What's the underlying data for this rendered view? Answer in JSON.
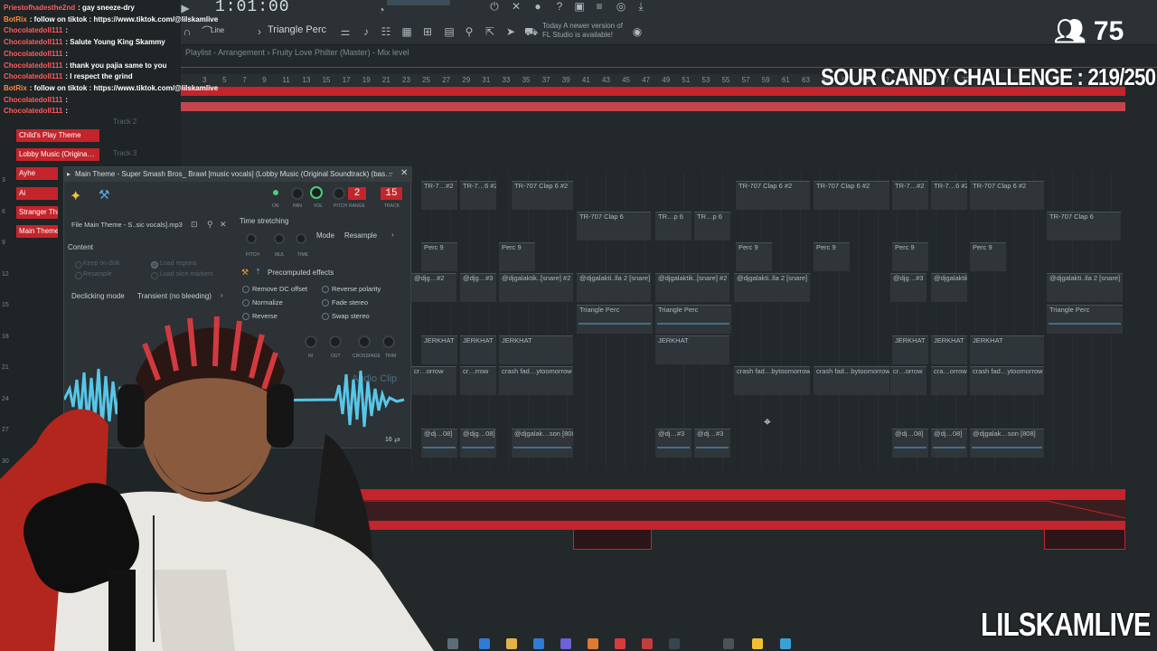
{
  "stream": {
    "viewer_count": "75",
    "challenge": "SOUR CANDY CHALLENGE : 219/250",
    "brand": "LILSKAMLIVE"
  },
  "toolbar": {
    "time": "1:01:00",
    "pattern": "Triangle Perc",
    "snap": "Line",
    "news_line1": "Today  A newer version of",
    "news_line2": "FL Studio is available!"
  },
  "playlist": {
    "title": "Playlist - Arrangement  ›  Fruity Love Philter (Master) - Mix level",
    "bar_numbers": [
      "3",
      "5",
      "7",
      "9",
      "11",
      "13",
      "15",
      "17",
      "19",
      "21",
      "23",
      "25",
      "27",
      "29",
      "31",
      "33",
      "35",
      "37",
      "39",
      "41",
      "43",
      "45",
      "47",
      "49",
      "51",
      "53",
      "55",
      "57",
      "59",
      "61",
      "63",
      "65",
      "67",
      "69",
      "71",
      "73",
      "75",
      "77",
      "79"
    ],
    "row_numbers": [
      "3",
      "6",
      "9",
      "12",
      "15",
      "18",
      "21",
      "24",
      "27",
      "30"
    ],
    "clips": [
      {
        "label": "TR-7…#2"
      },
      {
        "label": "TR-7…6 #2"
      },
      {
        "label": "TR-707 Clap 6 #2"
      },
      {
        "label": "TR-707 Clap 6 #2"
      },
      {
        "label": "TR-707 Clap 6 #2"
      },
      {
        "label": "TR-7…#2"
      },
      {
        "label": "TR-7…6 #2"
      },
      {
        "label": "TR-707 Clap 6 #2"
      },
      {
        "label": "TR-707 Clap 6"
      },
      {
        "label": "TR…p 6"
      },
      {
        "label": "TR…p 6"
      },
      {
        "label": "TR-707 Clap 6"
      },
      {
        "label": "Perc 9"
      },
      {
        "label": "Perc 9"
      },
      {
        "label": "Perc 9"
      },
      {
        "label": "Perc 9"
      },
      {
        "label": "Perc 9"
      },
      {
        "label": "Perc 9"
      },
      {
        "label": "@djg…#2"
      },
      {
        "label": "@djg…#3"
      },
      {
        "label": "@djgalaktik..[snare] #2"
      },
      {
        "label": "@djgalakti..lla 2 [snare]"
      },
      {
        "label": "@djgalaktik..[snare] #2"
      },
      {
        "label": "@djgalakti..lla 2 [snare]"
      },
      {
        "label": "@djg…#3"
      },
      {
        "label": "@djgalaktik..[snare] #2"
      },
      {
        "label": "@djgalakti..lla 2 [snare]"
      },
      {
        "label": "Triangle Perc"
      },
      {
        "label": "Triangle Perc"
      },
      {
        "label": "Triangle Perc"
      },
      {
        "label": "JERKHAT"
      },
      {
        "label": "JERKHAT"
      },
      {
        "label": "JERKHAT"
      },
      {
        "label": "JERKHAT"
      },
      {
        "label": "JERKHAT"
      },
      {
        "label": "JERKHAT"
      },
      {
        "label": "JERKHAT"
      },
      {
        "label": "cr…orrow"
      },
      {
        "label": "cr…rrow"
      },
      {
        "label": "crash fad…ytoomorrow"
      },
      {
        "label": "crash fad…bytoomorrow"
      },
      {
        "label": "crash fad…bytoomorrow"
      },
      {
        "label": "cr…orrow"
      },
      {
        "label": "cra…orrow"
      },
      {
        "label": "crash fad…ytoomorrow"
      },
      {
        "label": "@dj…08]"
      },
      {
        "label": "@djg…08]"
      },
      {
        "label": "@djgalak…son [808]"
      },
      {
        "label": "@dj…#3"
      },
      {
        "label": "@dj…#3"
      },
      {
        "label": "@dj…08]"
      },
      {
        "label": "@dj…08]"
      },
      {
        "label": "@djgalak…son [808]"
      }
    ]
  },
  "sidebar": {
    "tracks": [
      "Child's Play Theme",
      "Lobby Music (Origina…",
      "Ayhe",
      "Ai",
      "Stranger Thin",
      "Main Theme -"
    ],
    "ghost_tracks": [
      "Track 2",
      "Track 3"
    ]
  },
  "chat": [
    {
      "user": "Priestofhadesthe2nd",
      "msg": ": gay sneeze-dry",
      "bot": false
    },
    {
      "user": "BotRix",
      "msg": ": follow on tiktok : https://www.tiktok.com/@lilskamlive",
      "bot": true
    },
    {
      "user": "Chocolatedoll111",
      "msg": ":",
      "bot": false
    },
    {
      "user": "Chocolatedoll111",
      "msg": ": Salute Young King Skammy",
      "bot": false
    },
    {
      "user": "Chocolatedoll111",
      "msg": ":",
      "bot": false
    },
    {
      "user": "Chocolatedoll111",
      "msg": ": thank you pajia same to you",
      "bot": false
    },
    {
      "user": "Chocolatedoll111",
      "msg": ": I respect the grind",
      "bot": false
    },
    {
      "user": "BotRix",
      "msg": ": follow on tiktok : https://www.tiktok.com/@lilskamlive",
      "bot": true
    },
    {
      "user": "Chocolatedoll111",
      "msg": ":",
      "bot": false
    },
    {
      "user": "Chocolatedoll111",
      "msg": ":",
      "bot": false
    }
  ],
  "channel": {
    "title": "Main Theme - Super Smash Bros_ Brawl [music vocals] (Lobby Music (Original Soundtrack) (bas…",
    "file": "File  Main Theme - S..sic vocals].mp3",
    "pitch_range": "2",
    "track": "15",
    "knob_labels": [
      "ON",
      "PAN",
      "VOL",
      "PITCH",
      "RANGE",
      "TRACK"
    ],
    "time_stretching": "Time stretching",
    "mode_label": "Mode",
    "mode_value": "Resample",
    "stretch_knobs": [
      "PITCH",
      "MUL",
      "TIME"
    ],
    "content": "Content",
    "keep_on_disk": "Keep on disk",
    "resample": "Resample",
    "load_regions": "Load regions",
    "load_slice_markers": "Load slice markers",
    "precomputed": "Precomputed effects",
    "remove_dc": "Remove DC offset",
    "normalize": "Normalize",
    "reverse": "Reverse",
    "reverse_polarity": "Reverse polarity",
    "fade_stereo": "Fade stereo",
    "swap_stereo": "Swap stereo",
    "declicking_label": "Declicking mode",
    "declicking_value": "Transient (no bleeding)",
    "fx_knobs": [
      "IN",
      "OUT",
      "CROSSFADE",
      "TRIM"
    ],
    "audio_clip": "Audio Clip",
    "bits": "16"
  },
  "colors": {
    "accent_red": "#c4242b",
    "panel": "#2c3236",
    "background": "#23282b"
  }
}
